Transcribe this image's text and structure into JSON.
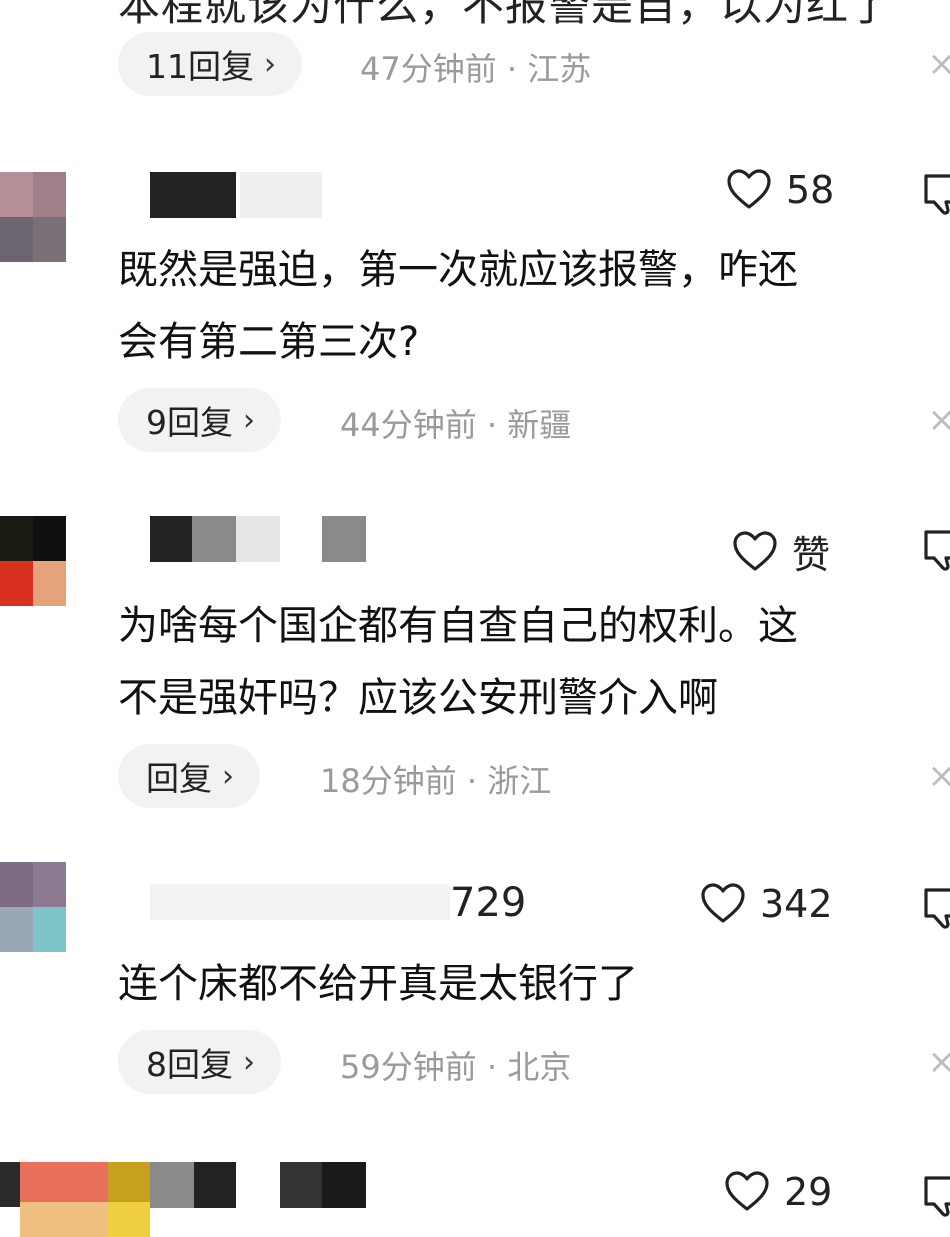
{
  "top_comment": {
    "cut_text": "本程就该为什么，不报警是自，以为红了",
    "reply_label": "11回复",
    "meta": "47分钟前 · 江苏"
  },
  "comments": [
    {
      "likes": "58",
      "text_line1": "既然是强迫，第一次就应该报警，咋还",
      "text_line2": "会有第二第三次?",
      "reply_label": "9回复",
      "meta": "44分钟前 · 新疆"
    },
    {
      "likes": "赞",
      "text_line1": "为啥每个国企都有自查自己的权利。这",
      "text_line2": "不是强奸吗？应该公安刑警介入啊",
      "reply_label": "回复",
      "meta": "18分钟前 · 浙江"
    },
    {
      "username_tail": "729",
      "likes": "342",
      "text_line1": "连个床都不给开真是太银行了",
      "reply_label": "8回复",
      "meta": "59分钟前 · 北京"
    },
    {
      "likes": "29"
    }
  ],
  "icons": {
    "chevron": "chevron-right-icon",
    "close": "close-icon",
    "like": "heart-outline-icon",
    "dislike": "thumbs-down-outline-icon"
  },
  "glyphs": {
    "chevron": "›",
    "close": "×"
  }
}
